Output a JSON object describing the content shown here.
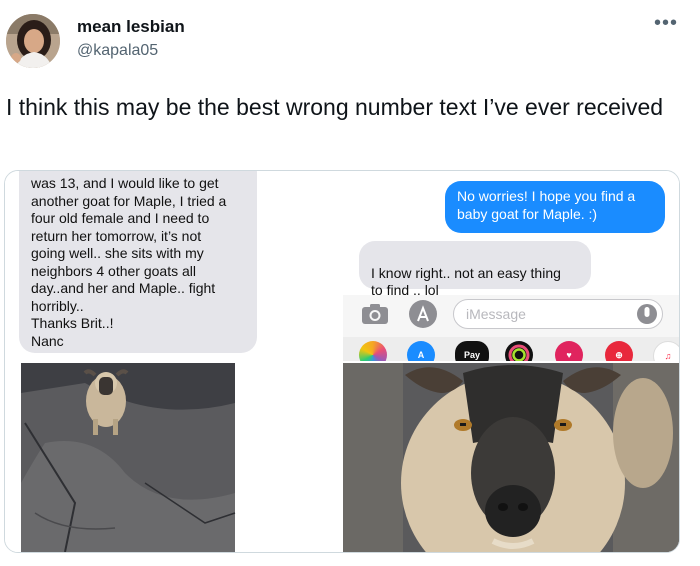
{
  "tweet": {
    "display_name": "mean lesbian",
    "handle": "@kapala05",
    "more_icon": "more-dots-icon",
    "text": "I think this may be the best wrong number text I’ve ever received"
  },
  "screenshot_left": {
    "message": "was 13, and I would like to get\nanother goat for Maple, I tried a\nfour old female and I need to\nreturn her tomorrow, it’s not\ngoing well.. she sits with my\nneighbors 4 other goats all\nday..and her and Maple.. fight\nhorribly..\nThanks Brit..!\nNanc"
  },
  "screenshot_right": {
    "sent_message": "No worries! I hope you find a\nbaby goat for Maple. :)",
    "received_message": "I know right.. not an easy thing\nto find .. lol",
    "received_emoji": "💗🐐💗",
    "imessage_placeholder": "iMessage",
    "apple_pay_label": "Pay"
  },
  "colors": {
    "imessage_blue": "#1a8cff",
    "gray_bubble": "#e5e5ea",
    "twitter_gray": "#536471"
  }
}
